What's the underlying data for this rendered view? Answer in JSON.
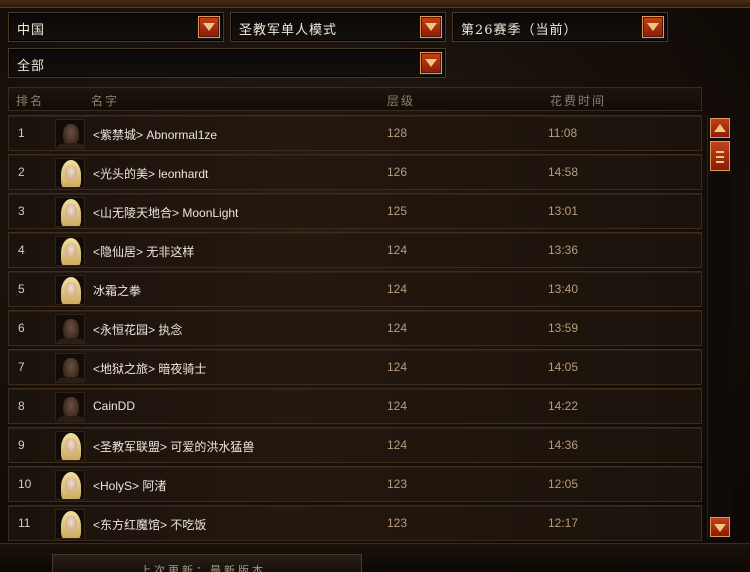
{
  "filters": {
    "region": "中国",
    "mode": "圣教军单人模式",
    "season": "第26赛季（当前）",
    "class_filter": "全部"
  },
  "table": {
    "headers": {
      "rank": "排名",
      "name": "名字",
      "level": "层级",
      "time": "花费时间"
    },
    "rows": [
      {
        "rank": "1",
        "name": "<紫禁城> Abnormal1ze",
        "level": "128",
        "time": "11:08",
        "portrait": "male"
      },
      {
        "rank": "2",
        "name": "<光头的美> leonhardt",
        "level": "126",
        "time": "14:58",
        "portrait": "female"
      },
      {
        "rank": "3",
        "name": "<山无陵天地合> MoonLight",
        "level": "125",
        "time": "13:01",
        "portrait": "female"
      },
      {
        "rank": "4",
        "name": "<隐仙居> 无非这样",
        "level": "124",
        "time": "13:36",
        "portrait": "female"
      },
      {
        "rank": "5",
        "name": "冰霜之拳",
        "level": "124",
        "time": "13:40",
        "portrait": "female"
      },
      {
        "rank": "6",
        "name": "<永恒花园> 执念",
        "level": "124",
        "time": "13:59",
        "portrait": "male"
      },
      {
        "rank": "7",
        "name": "<地狱之旅> 暗夜骑士",
        "level": "124",
        "time": "14:05",
        "portrait": "male"
      },
      {
        "rank": "8",
        "name": "CainDD",
        "level": "124",
        "time": "14:22",
        "portrait": "male"
      },
      {
        "rank": "9",
        "name": "<圣教军联盟> 可爱的洪水猛兽",
        "level": "124",
        "time": "14:36",
        "portrait": "female"
      },
      {
        "rank": "10",
        "name": "<HolyS> 阿渚",
        "level": "123",
        "time": "12:05",
        "portrait": "female"
      },
      {
        "rank": "11",
        "name": "<东方红魔馆> 不吃饭",
        "level": "123",
        "time": "12:17",
        "portrait": "female"
      }
    ]
  },
  "footer": {
    "text": "上次更新：最新版本"
  },
  "colors": {
    "accent": "#b8360f",
    "accent_border": "#e09a55",
    "value_text": "#b79d7c"
  },
  "icons": {
    "dropdown": "chevron-down-icon",
    "scroll_up": "arrow-up-icon",
    "scroll_down": "arrow-down-icon"
  }
}
